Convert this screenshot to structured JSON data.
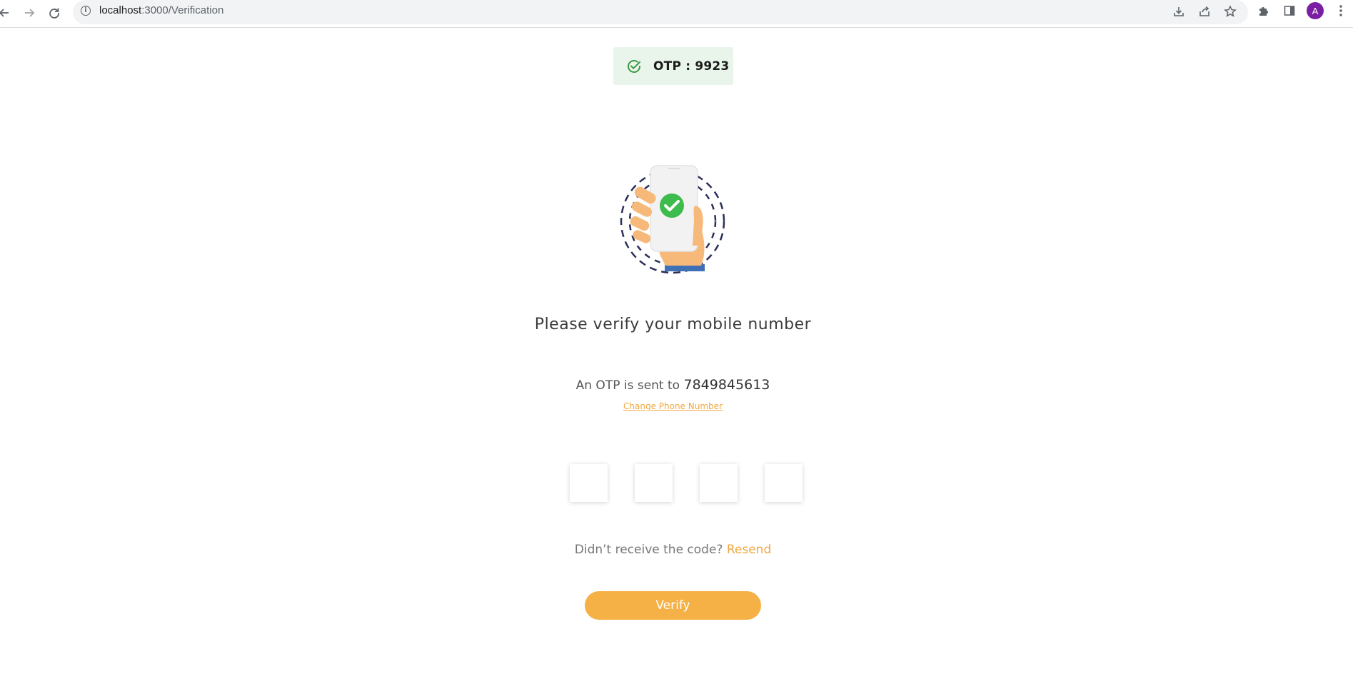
{
  "browser": {
    "url_host": "localhost",
    "url_path": ":3000/Verification",
    "avatar_letter": "A",
    "icons": {
      "back": "back-arrow-icon",
      "forward": "forward-arrow-icon",
      "reload": "reload-icon",
      "site_info": "info-icon",
      "install": "install-icon",
      "share": "share-icon",
      "bookmark": "star-icon",
      "extensions": "puzzle-icon",
      "side_panel": "side-panel-icon",
      "menu": "kebab-menu-icon"
    }
  },
  "toast": {
    "text": "OTP : 9923",
    "icon": "check-circle-icon",
    "background": "#e9f5ea",
    "icon_color": "#3a9a46"
  },
  "verification": {
    "title": "Please verify your mobile number",
    "sent_prefix": "An OTP is sent to",
    "phone": "7849845613",
    "change_phone": "Change Phone Number",
    "otp_inputs": [
      "",
      "",
      "",
      ""
    ],
    "resend_prefix": "Didn’t receive the code?",
    "resend_label": "Resend",
    "verify_label": "Verify"
  },
  "colors": {
    "accent": "#f6b146",
    "link": "#f0a840",
    "illustration_check": "#3dbb4c",
    "illustration_skin": "#f6b97a",
    "illustration_cuff": "#3f6fb5",
    "illustration_ring": "#2b2f5a"
  }
}
